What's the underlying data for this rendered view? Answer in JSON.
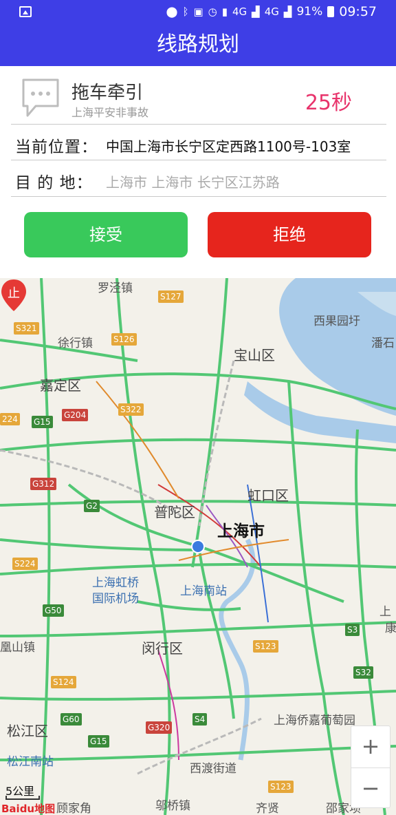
{
  "status_bar": {
    "battery": "91%",
    "time": "09:57",
    "network_1": "4G",
    "network_2": "4G"
  },
  "title": "线路规划",
  "service": {
    "title": "拖车牵引",
    "subtitle": "上海平安非事故",
    "countdown": "25秒"
  },
  "fields": {
    "current_label": "当前位置：",
    "current_value": "中国上海市长宁区定西路1100号-103室",
    "dest_label": "目 的 地：",
    "dest_value": "上海市 上海市 长宁区江苏路"
  },
  "buttons": {
    "accept": "接受",
    "reject": "拒绝"
  },
  "map": {
    "labels": {
      "luojing": "罗泾镇",
      "xiguoyu": "西果园圩",
      "xuhang": "徐行镇",
      "baoshan": "宝山区",
      "panshi": "潘石",
      "jiading": "嘉定区",
      "hongkou": "虹口区",
      "putuo": "普陀区",
      "shanghai": "上海市",
      "hongqiao": "上海虹桥\n国际机场",
      "hongqiao_1": "上海虹桥",
      "hongqiao_2": "国际机场",
      "south_station": "上海南站",
      "minhang": "闵行区",
      "jiuting": "凰山镇",
      "songjiang": "松江区",
      "songjiang_south": "松江南站",
      "qiaojia": "上海侨嘉葡萄园",
      "xidu": "西渡街道",
      "gujiao": "顾家角",
      "zhuqiao": "邬桥镇",
      "qixian": "齐贤",
      "shaojiabang": "邵家坝",
      "shang_right": "上",
      "kang_right": "康"
    },
    "badges": {
      "s127": "S127",
      "s321": "S321",
      "s126": "S126",
      "s224a": "224",
      "g15": "G15",
      "g204": "G204",
      "s322": "S322",
      "g312": "G312",
      "g2": "G2",
      "s224b": "S224",
      "g50": "G50",
      "s3": "S3",
      "s123a": "S123",
      "s32": "S32",
      "s124": "S124",
      "g60": "G60",
      "g320": "G320",
      "s4": "S4",
      "g15b": "G15",
      "s123b": "S123"
    },
    "scale": "5公里",
    "brand": "Baidu地图",
    "marker_char": "止",
    "zoom_in": "+",
    "zoom_out": "−"
  }
}
